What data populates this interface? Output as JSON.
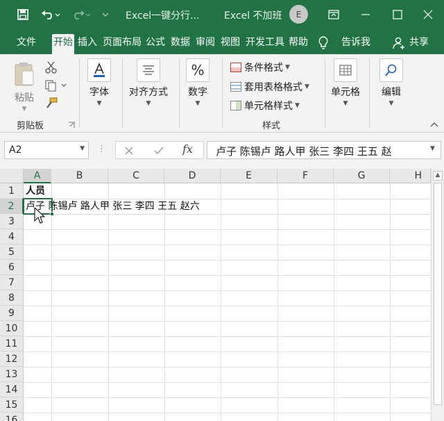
{
  "titlebar": {
    "save_icon": "save-icon",
    "undo_icon": "undo-icon",
    "redo_icon": "redo-icon",
    "customize_icon": "chevron-down-icon",
    "document_title": "Excel一键分行...",
    "app_name": "Excel 不加班",
    "user_initial": "E",
    "colors": {
      "bar": "#217346",
      "text": "#ffffff"
    }
  },
  "tabs": [
    {
      "label": "文件"
    },
    {
      "label": "开始",
      "active": true
    },
    {
      "label": "插入"
    },
    {
      "label": "页面布局"
    },
    {
      "label": "公式"
    },
    {
      "label": "数据"
    },
    {
      "label": "审阅"
    },
    {
      "label": "视图"
    },
    {
      "label": "开发工具"
    },
    {
      "label": "帮助"
    },
    {
      "label": "告诉我"
    },
    {
      "label": "共享"
    }
  ],
  "ribbon": {
    "clipboard": {
      "paste": "粘贴",
      "group": "剪贴板"
    },
    "font": {
      "label": "字体"
    },
    "alignment": {
      "label": "对齐方式"
    },
    "number": {
      "label": "数字"
    },
    "styles": {
      "conditional": "条件格式",
      "table_format": "套用表格格式",
      "cell_styles": "单元格样式",
      "group": "样式"
    },
    "cells": {
      "label": "单元格"
    },
    "editing": {
      "label": "编辑"
    }
  },
  "formula_bar": {
    "name_box": "A2",
    "fx": "fx",
    "content": "卢子 陈锡卢 路人甲 张三 李四 王五 赵"
  },
  "sheet": {
    "columns": [
      "A",
      "B",
      "C",
      "D",
      "E",
      "F",
      "G",
      "H"
    ],
    "rows": [
      "1",
      "2",
      "3",
      "4",
      "5",
      "6",
      "7",
      "8",
      "9",
      "10",
      "11",
      "12",
      "13",
      "14",
      "15",
      "16"
    ],
    "a1": "人员",
    "a2": "卢子 陈锡卢 路人甲 张三 李四 王五 赵六",
    "selected_cell": "A2"
  }
}
